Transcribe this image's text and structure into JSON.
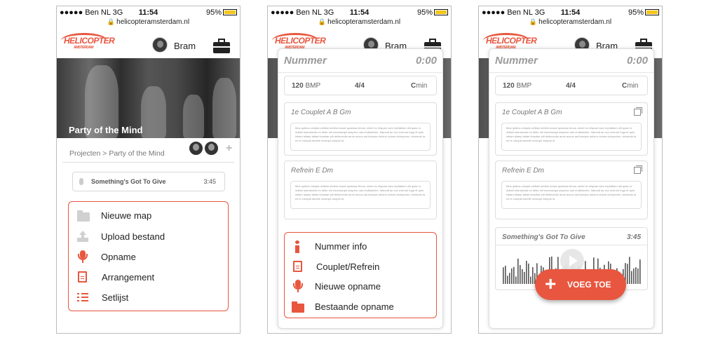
{
  "status": {
    "carrier": "●●●●● Ben NL  3G",
    "time": "11:54",
    "battery": "95%"
  },
  "url": "helicopteramsterdam.nl",
  "header": {
    "username": "Bram",
    "logo_text": "HELICOPTER",
    "logo_sub": "AMSTERDAM"
  },
  "screen1": {
    "project_title": "Party of the Mind",
    "breadcrumb": "Projecten > Party of the Mind",
    "track": {
      "name": "Something's Got To Give",
      "duration": "3:45"
    },
    "menu": [
      {
        "label": "Nieuwe map",
        "icon": "folder-icon"
      },
      {
        "label": "Upload bestand",
        "icon": "upload-icon"
      },
      {
        "label": "Opname",
        "icon": "microphone-icon"
      },
      {
        "label": "Arrangement",
        "icon": "document-icon"
      },
      {
        "label": "Setlijst",
        "icon": "list-icon"
      }
    ]
  },
  "song": {
    "title": "Nummer",
    "time": "0:00",
    "bpm_value": "120",
    "bpm_unit": "BMP",
    "signature": "4/4",
    "key_letter": "C",
    "key_mode": "min",
    "sections": [
      {
        "title": "1e Couplet A B Gm",
        "lyrics": "Mus quibus volupta velliam sedest ocsae quatusa nimus, simet ex eliquae nam repitatium ulit quas ro dollatt mandundis ex itetur mil escessequi asspero oan endiksenim. Itamodl au occ everum fuga et quis intiam aliaep tatiae ibusdae plit dellenectis arum accus aut facepra dolorro dolum dolorporen, simenda la es re volupta facelte onsequi volupto la"
      },
      {
        "title": "Refrein E Dm",
        "lyrics": "Mus quibus volupta velliam sedest ocsae quatusa nimus, simet ex eliquae nam repitatium ulit quas ro dollatt mandundis ex itetur mil escessequi asspero oan endiksenim. Itamodl au occ everum fuga et quis intiam aliaep tatiae ibusdae plit dellenectis arum accus aut facepra dolorro dolum dolorporen, simenda la es re volupta facelte onsequi volupto la"
      }
    ]
  },
  "screen2": {
    "menu": [
      {
        "label": "Nummer info",
        "icon": "info-icon"
      },
      {
        "label": "Couplet/Refrein",
        "icon": "document-icon"
      },
      {
        "label": "Nieuwe opname",
        "icon": "microphone-icon"
      },
      {
        "label": "Bestaande opname",
        "icon": "folder-icon"
      }
    ]
  },
  "screen3": {
    "recording": {
      "name": "Something's Got To Give",
      "duration": "3:45"
    },
    "fab_label": "VOEG TOE"
  },
  "colors": {
    "accent": "#e8563f",
    "muted": "#9a9a9a",
    "border": "#dddddd"
  }
}
